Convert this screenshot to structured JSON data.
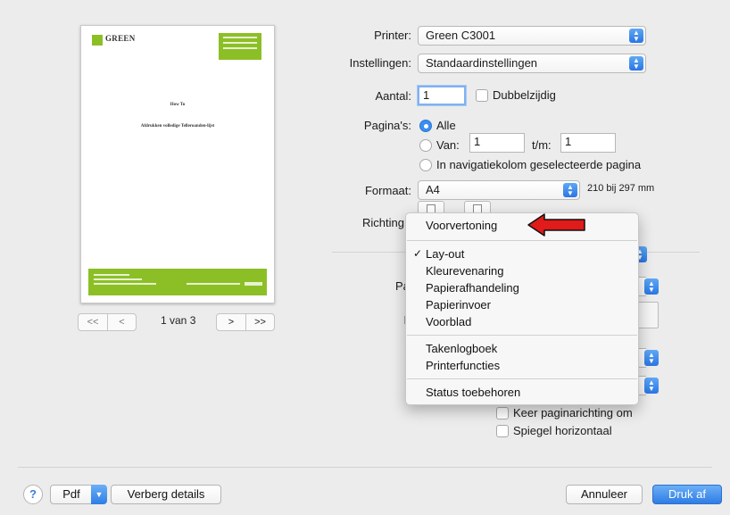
{
  "preview": {
    "logo": "GREEN",
    "title": "How To",
    "subtitle": "Afdrukken volledige Telleroanden-lijst",
    "page_info": "1 van 3",
    "nav_first": "<<",
    "nav_prev": "<",
    "nav_next": ">",
    "nav_last": ">>"
  },
  "printer": {
    "label": "Printer:",
    "value": "Green C3001"
  },
  "presets": {
    "label": "Instellingen:",
    "value": "Standaardinstellingen"
  },
  "copies": {
    "label": "Aantal:",
    "value": "1",
    "two_sided": "Dubbelzijdig"
  },
  "pages": {
    "label": "Pagina's:",
    "all": "Alle",
    "from": "Van:",
    "from_value": "1",
    "to": "t/m:",
    "to_value": "1",
    "selected_sidebar": "In navigatiekolom geselecteerde pagina"
  },
  "paper_size": {
    "label": "Formaat:",
    "value": "A4",
    "dimensions": "210 bij 297 mm"
  },
  "orientation": {
    "label": "Richting"
  },
  "hidden_partial": {
    "pa": "Pa",
    "l": "L"
  },
  "menu": {
    "items": [
      "Voorvertoning",
      "Lay-out",
      "Kleurevenaring",
      "Papierafhandeling",
      "Papierinvoer",
      "Voorblad",
      "Takenlogboek",
      "Printerfuncties",
      "Status toebehoren"
    ],
    "checked": "Lay-out"
  },
  "layout_options": {
    "reverse_orientation": "Keer paginarichting om",
    "flip_horizontal": "Spiegel horizontaal"
  },
  "footer": {
    "help": "?",
    "pdf": "Pdf",
    "hide_details": "Verberg details",
    "cancel": "Annuleer",
    "print": "Druk af"
  },
  "colors": {
    "accent": "#2f7de5",
    "annotation_arrow": "#e11a1a",
    "brand_green": "#8cbf26"
  }
}
